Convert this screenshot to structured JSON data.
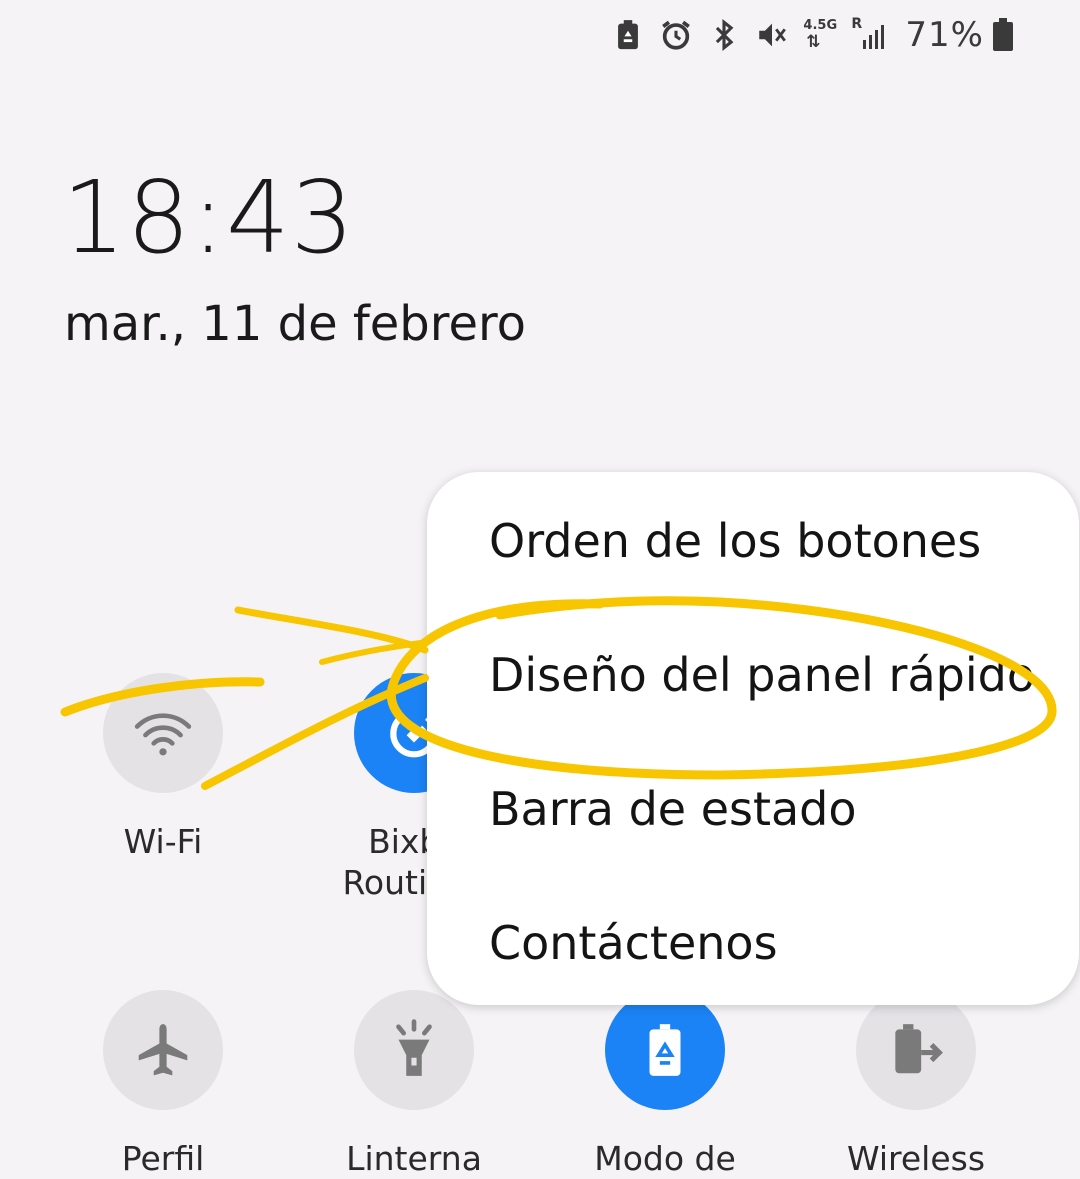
{
  "status_bar": {
    "icons": [
      "battery-saver-icon",
      "alarm-icon",
      "bluetooth-icon",
      "mute-icon",
      "network-4-5g-icon",
      "roaming-signal-icon",
      "battery-icon"
    ],
    "network_label": "4.5G",
    "roaming_label": "R",
    "battery_text": "71%"
  },
  "clock": {
    "time": "18:43",
    "date": "mar., 11 de febrero"
  },
  "tiles_row1": [
    {
      "label": "Wi-Fi",
      "icon": "wifi-icon",
      "active": false
    },
    {
      "label": "Bixby\nRoutines",
      "icon": "bixby-routines-icon",
      "active": true
    }
  ],
  "tiles_row2": [
    {
      "label": "Perfil",
      "icon": "airplane-icon",
      "active": false
    },
    {
      "label": "Linterna",
      "icon": "flashlight-icon",
      "active": false
    },
    {
      "label": "Modo de",
      "icon": "battery-recycle-icon",
      "active": true
    },
    {
      "label": "Wireless",
      "icon": "wireless-powershare-icon",
      "active": false
    }
  ],
  "menu": {
    "items": [
      "Orden de los botones",
      "Diseño del panel rápido",
      "Barra de estado",
      "Contáctenos"
    ]
  },
  "colors": {
    "accent": "#1b83f5",
    "tile_off": "#e4e2e5",
    "annotation": "#f7c600",
    "background": "#f5f3f5"
  }
}
